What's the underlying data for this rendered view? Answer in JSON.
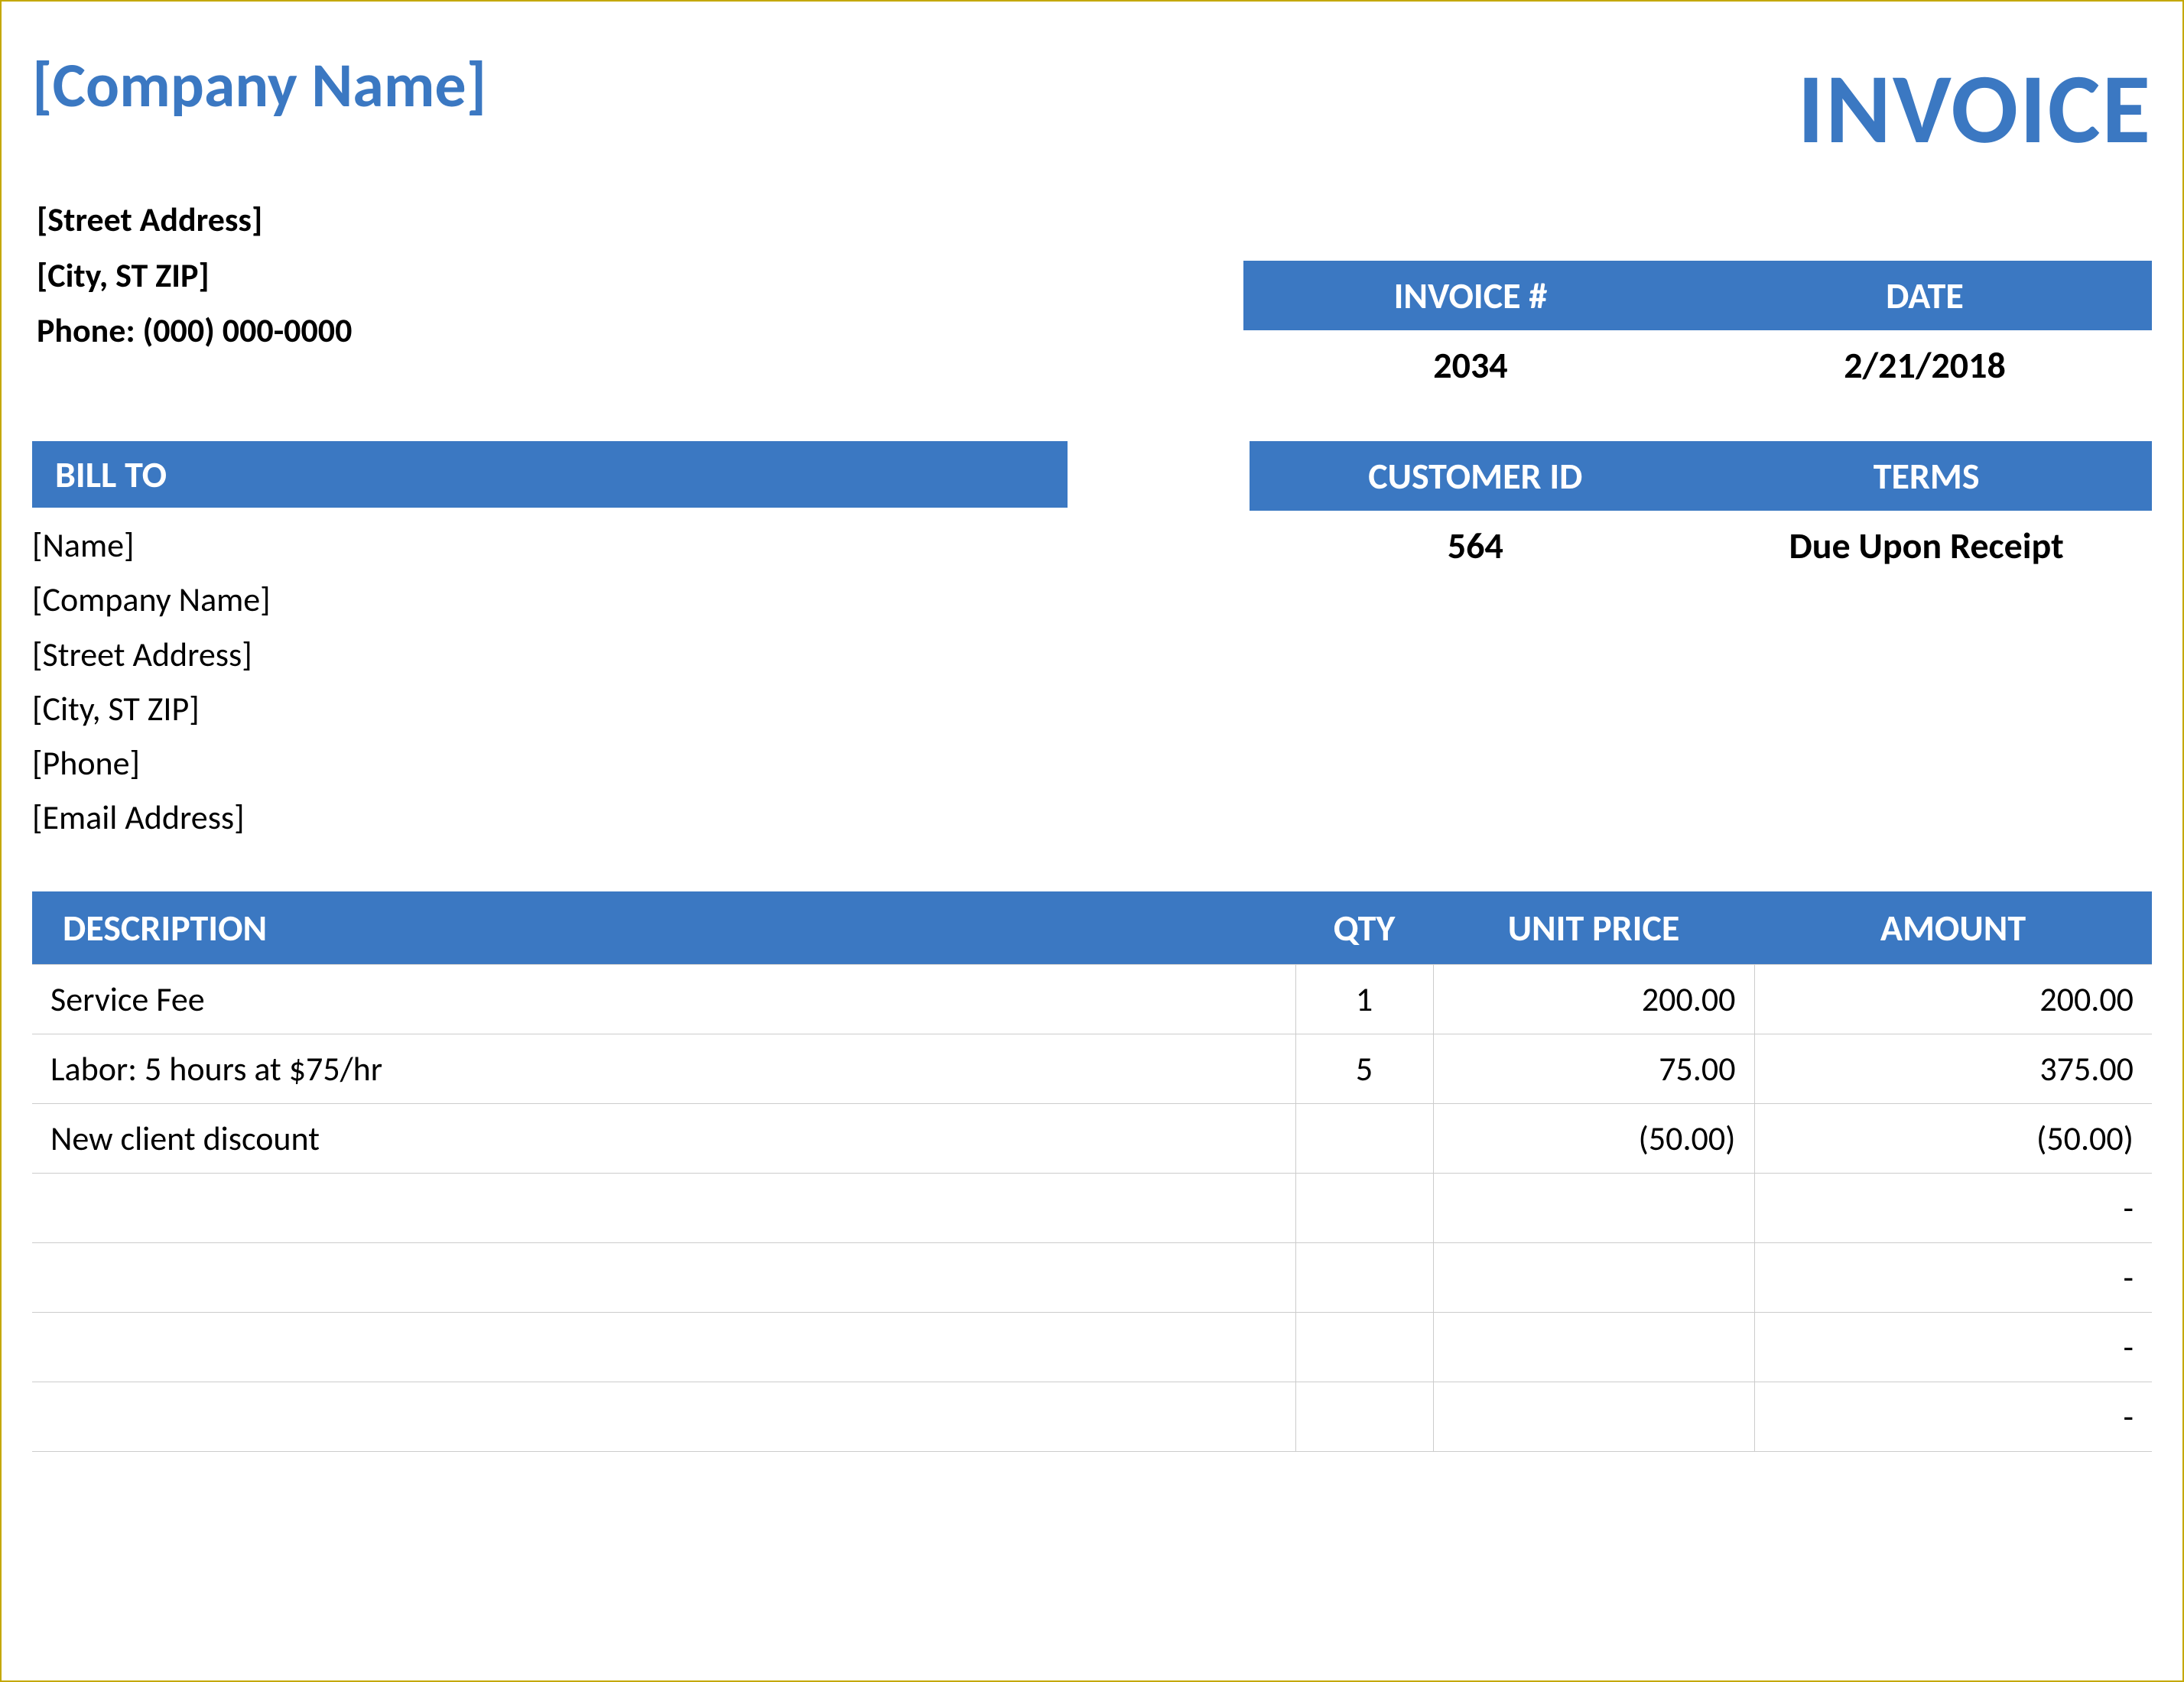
{
  "header": {
    "company_name": "[Company Name]",
    "invoice_title": "INVOICE"
  },
  "company": {
    "street": "[Street Address]",
    "city": "[City, ST  ZIP]",
    "phone": "Phone: (000) 000-0000"
  },
  "meta1": {
    "invoice_num_label": "INVOICE #",
    "invoice_num_value": "2034",
    "date_label": "DATE",
    "date_value": "2/21/2018"
  },
  "billto": {
    "header": "BILL TO",
    "name": "[Name]",
    "company": "[Company Name]",
    "street": "[Street Address]",
    "city": "[City, ST  ZIP]",
    "phone": "[Phone]",
    "email": "[Email Address]"
  },
  "meta2": {
    "customer_id_label": "CUSTOMER ID",
    "customer_id_value": "564",
    "terms_label": "TERMS",
    "terms_value": "Due Upon Receipt"
  },
  "table": {
    "headers": {
      "description": "DESCRIPTION",
      "qty": "QTY",
      "unit_price": "UNIT PRICE",
      "amount": "AMOUNT"
    },
    "rows": [
      {
        "description": "Service Fee",
        "qty": "1",
        "unit_price": "200.00",
        "amount": "200.00"
      },
      {
        "description": "Labor: 5 hours at $75/hr",
        "qty": "5",
        "unit_price": "75.00",
        "amount": "375.00"
      },
      {
        "description": "New client discount",
        "qty": "",
        "unit_price": "(50.00)",
        "amount": "(50.00)"
      },
      {
        "description": "",
        "qty": "",
        "unit_price": "",
        "amount": "-"
      },
      {
        "description": "",
        "qty": "",
        "unit_price": "",
        "amount": "-"
      },
      {
        "description": "",
        "qty": "",
        "unit_price": "",
        "amount": "-"
      },
      {
        "description": "",
        "qty": "",
        "unit_price": "",
        "amount": "-"
      }
    ]
  }
}
